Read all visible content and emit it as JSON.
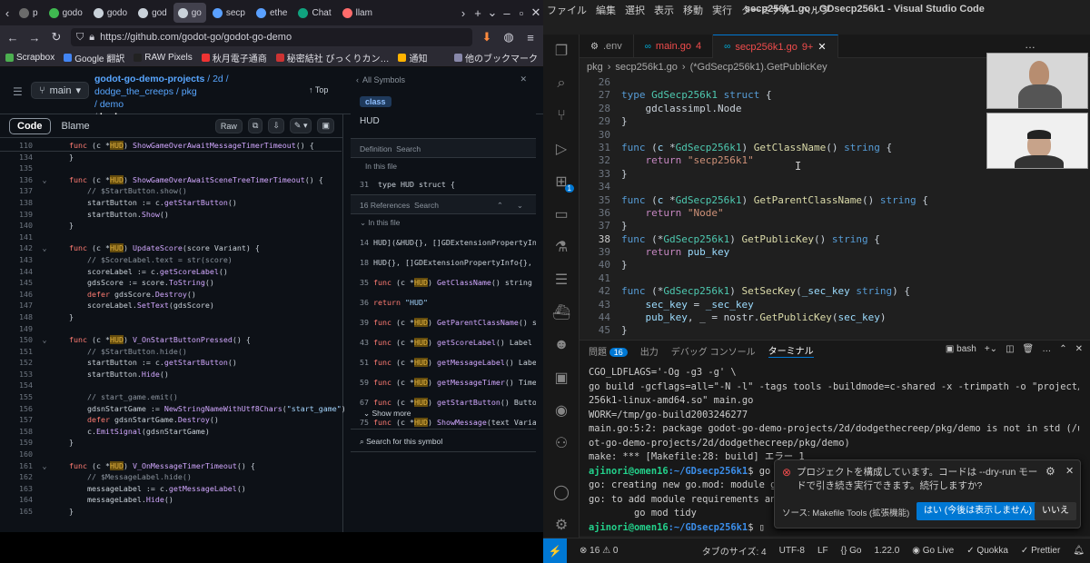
{
  "browser": {
    "tabs": [
      {
        "label": "p",
        "color": "#6b6b6b"
      },
      {
        "label": "godo",
        "color": "#3fb950"
      },
      {
        "label": "godo",
        "color": "#c9d1d9"
      },
      {
        "label": "god",
        "color": "#c9d1d9"
      },
      {
        "label": "go",
        "color": "#c9d1d9"
      },
      {
        "label": "secp",
        "color": "#5aa0ff"
      },
      {
        "label": "ethe",
        "color": "#5aa0ff"
      },
      {
        "label": "Chat",
        "color": "#10a37f"
      },
      {
        "label": "llam",
        "color": "#ff6b6b"
      }
    ],
    "url": "https://github.com/godot-go/godot-go-demo",
    "bookmarks": [
      "Scrapbox",
      "Google 翻訳",
      "RAW Pixels",
      "秋月電子通商",
      "秘密結社 びっくりカン…",
      "通知",
      "他のブックマーク"
    ],
    "github": {
      "branch": "main",
      "path_repo": "godot-go-demo-projects",
      "path_rest": "/ 2d / dodge_the_creeps / pkg",
      "path_demo": "/ demo",
      "file": "hud.go",
      "top_label": "Top",
      "code_tab": "Code",
      "blame_tab": "Blame",
      "raw_label": "Raw"
    },
    "code_lines": [
      {
        "n": "110",
        "t": "    func (c *HUD) ShowGameOverAwaitMessageTimerTimeout() {"
      },
      {
        "n": "134",
        "t": "    }"
      },
      {
        "n": "135",
        "t": ""
      },
      {
        "n": "136",
        "t": "    func (c *HUD) ShowGameOverAwaitSceneTreeTimerTimeout() {",
        "fold": true
      },
      {
        "n": "137",
        "t": "        // $StartButton.show()"
      },
      {
        "n": "138",
        "t": "        startButton := c.getStartButton()"
      },
      {
        "n": "139",
        "t": "        startButton.Show()"
      },
      {
        "n": "140",
        "t": "    }"
      },
      {
        "n": "141",
        "t": ""
      },
      {
        "n": "142",
        "t": "    func (c *HUD) UpdateScore(score Variant) {",
        "fold": true
      },
      {
        "n": "143",
        "t": "        // $ScoreLabel.text = str(score)"
      },
      {
        "n": "144",
        "t": "        scoreLabel := c.getScoreLabel()"
      },
      {
        "n": "145",
        "t": "        gdsScore := score.ToString()"
      },
      {
        "n": "146",
        "t": "        defer gdsScore.Destroy()"
      },
      {
        "n": "147",
        "t": "        scoreLabel.SetText(gdsScore)"
      },
      {
        "n": "148",
        "t": "    }"
      },
      {
        "n": "149",
        "t": ""
      },
      {
        "n": "150",
        "t": "    func (c *HUD) V_OnStartButtonPressed() {",
        "fold": true
      },
      {
        "n": "151",
        "t": "        // $StartButton.hide()"
      },
      {
        "n": "152",
        "t": "        startButton := c.getStartButton()"
      },
      {
        "n": "153",
        "t": "        startButton.Hide()"
      },
      {
        "n": "154",
        "t": ""
      },
      {
        "n": "155",
        "t": "        // start_game.emit()"
      },
      {
        "n": "156",
        "t": "        gdsnStartGame := NewStringNameWithUtf8Chars(\"start_game\")"
      },
      {
        "n": "157",
        "t": "        defer gdsnStartGame.Destroy()"
      },
      {
        "n": "158",
        "t": "        c.EmitSignal(gdsnStartGame)"
      },
      {
        "n": "159",
        "t": "    }"
      },
      {
        "n": "160",
        "t": ""
      },
      {
        "n": "161",
        "t": "    func (c *HUD) V_OnMessageTimerTimeout() {",
        "fold": true
      },
      {
        "n": "162",
        "t": "        // $MessageLabel.hide()"
      },
      {
        "n": "163",
        "t": "        messageLabel := c.getMessageLabel()"
      },
      {
        "n": "164",
        "t": "        messageLabel.Hide()"
      },
      {
        "n": "165",
        "t": "    }"
      }
    ],
    "symbols": {
      "header": "All Symbols",
      "kind": "class",
      "name": "HUD",
      "tab_definition": "Definition",
      "tab_search": "Search",
      "in_file": "In this file",
      "def_line": "31",
      "def_text": "type HUD struct {",
      "refs_label": "16 References",
      "refs_search": "Search",
      "refs_in_file": "In this file",
      "refs": [
        {
          "n": "14",
          "t": "HUD](&HUD{}, []GDExtensionPropertyInfo"
        },
        {
          "n": "18",
          "t": "HUD{}, []GDExtensionPropertyInfo{}, ni"
        },
        {
          "n": "35",
          "t": "func (c *HUD) GetClassName() string {"
        },
        {
          "n": "36",
          "t": "return \"HUD\""
        },
        {
          "n": "39",
          "t": "func (c *HUD) GetParentClassName() str"
        },
        {
          "n": "43",
          "t": "func (c *HUD) getScoreLabel() Label {"
        },
        {
          "n": "51",
          "t": "func (c *HUD) getMessageLabel() Label"
        },
        {
          "n": "59",
          "t": "func (c *HUD) getMessageTimer() Timer"
        },
        {
          "n": "67",
          "t": "func (c *HUD) getStartButton() Button"
        },
        {
          "n": "75",
          "t": "func (c *HUD) ShowMessage(text Variant"
        }
      ],
      "show_more": "Show more",
      "search_symbol": "Search for this symbol"
    }
  },
  "vscode": {
    "title": "secp256k1.go - GDsecp256k1 - Visual Studio Code",
    "menu": [
      "ファイル",
      "編集",
      "選択",
      "表示",
      "移動",
      "実行",
      "ターミナル",
      "ヘルプ"
    ],
    "tabs": [
      {
        "label": ".env",
        "badge": ""
      },
      {
        "label": "main.go",
        "badge": "4"
      },
      {
        "label": "secp256k1.go",
        "badge": "9+"
      }
    ],
    "breadcrumb": [
      "pkg",
      "secp256k1.go",
      "(*GdSecp256k1).GetPublicKey"
    ],
    "activity_badge": "1",
    "editor_lines": [
      {
        "n": "26",
        "t": ""
      },
      {
        "n": "27",
        "t": "type GdSecp256k1 struct {"
      },
      {
        "n": "28",
        "t": "    gdclassimpl.Node"
      },
      {
        "n": "29",
        "t": "}"
      },
      {
        "n": "30",
        "t": ""
      },
      {
        "n": "31",
        "t": "func (c *GdSecp256k1) GetClassName() string {"
      },
      {
        "n": "32",
        "t": "    return \"secp256k1\""
      },
      {
        "n": "33",
        "t": "}"
      },
      {
        "n": "34",
        "t": ""
      },
      {
        "n": "35",
        "t": "func (c *GdSecp256k1) GetParentClassName() string {"
      },
      {
        "n": "36",
        "t": "    return \"Node\""
      },
      {
        "n": "37",
        "t": "}"
      },
      {
        "n": "38",
        "t": "func (*GdSecp256k1) GetPublicKey() string {"
      },
      {
        "n": "39",
        "t": "    return pub_key"
      },
      {
        "n": "40",
        "t": "}"
      },
      {
        "n": "41",
        "t": ""
      },
      {
        "n": "42",
        "t": "func (*GdSecp256k1) SetSecKey(_sec_key string) {"
      },
      {
        "n": "43",
        "t": "    sec_key = _sec_key"
      },
      {
        "n": "44",
        "t": "    pub_key, _ = nostr.GetPublicKey(sec_key)"
      },
      {
        "n": "45",
        "t": "}"
      }
    ],
    "panel_tabs": [
      "問題",
      "出力",
      "デバッグ コンソール",
      "ターミナル"
    ],
    "problems_count": "16",
    "terminal_shell": "bash",
    "terminal_lines": [
      "CGO_LDFLAGS='-Og -g3 -g' \\",
      "go build -gcflags=all=\"-N -l\" -tags tools -buildmode=c-shared -x -trimpath -o \"project/lib/libgodotgo-secp",
      "256k1-linux-amd64.so\" main.go",
      "WORK=/tmp/go-build2003246277",
      "main.go:5:2: package godot-go-demo-projects/2d/dodgethecreep/pkg/demo is not in std (/usr/local/go/src/god",
      "ot-go-demo-projects/2d/dodgethecreep/pkg/demo)",
      "make: *** [Makefile:28: build] エラー 1"
    ],
    "prompt_user": "ajinori@omen16",
    "prompt_path": ":~/GDsecp256k1",
    "prompt_cmd1": "$ go mod init",
    "term_after": [
      "go: creating new go.mod: module github.c",
      "go: to add module requirements and sums:",
      "        go mod tidy"
    ],
    "prompt_cmd2": "$ ",
    "notification": {
      "message": "プロジェクトを構成しています。コードは --dry-run モードで引き続き実行できます。続行しますか?",
      "source": "ソース: Makefile Tools (拡張機能)",
      "primary": "はい (今後は表示しません)",
      "secondary": "いいえ"
    },
    "status": {
      "errors": "16",
      "warnings": "0",
      "tab_size": "タブのサイズ: 4",
      "encoding": "UTF-8",
      "eol": "LF",
      "lang": "Go",
      "version": "1.22.0",
      "golive": "Go Live",
      "quokka": "Quokka",
      "prettier": "Prettier"
    }
  },
  "colors": {
    "accent": "#0078d4",
    "github_bg": "#0d1117",
    "vscode_bg": "#1f1f1f",
    "highlight": "#634b0d"
  }
}
